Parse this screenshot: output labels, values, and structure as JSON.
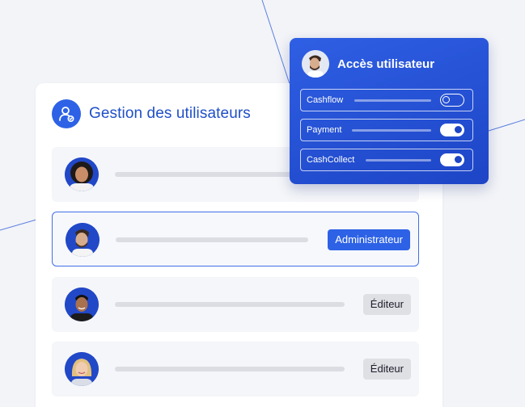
{
  "theme": {
    "accent": "#2d62e6",
    "title_color": "#1f4fc8",
    "popup_bg": "#2350d6",
    "editor_badge_bg": "#dfe0e4"
  },
  "panel": {
    "title": "Gestion des utilisateurs",
    "icon": "user-management-icon",
    "users": [
      {
        "avatar": "woman-curly-hair",
        "role": "",
        "selected": false
      },
      {
        "avatar": "man-beard-profile",
        "role": "Administrateur",
        "selected": true
      },
      {
        "avatar": "man-smiling",
        "role": "Éditeur",
        "selected": false
      },
      {
        "avatar": "woman-blonde",
        "role": "Éditeur",
        "selected": false
      }
    ]
  },
  "access": {
    "title": "Accès utilisateur",
    "avatar": "man-beard-profile",
    "permissions": [
      {
        "label": "Cashflow",
        "enabled": false
      },
      {
        "label": "Payment",
        "enabled": true
      },
      {
        "label": "CashCollect",
        "enabled": true
      }
    ]
  }
}
